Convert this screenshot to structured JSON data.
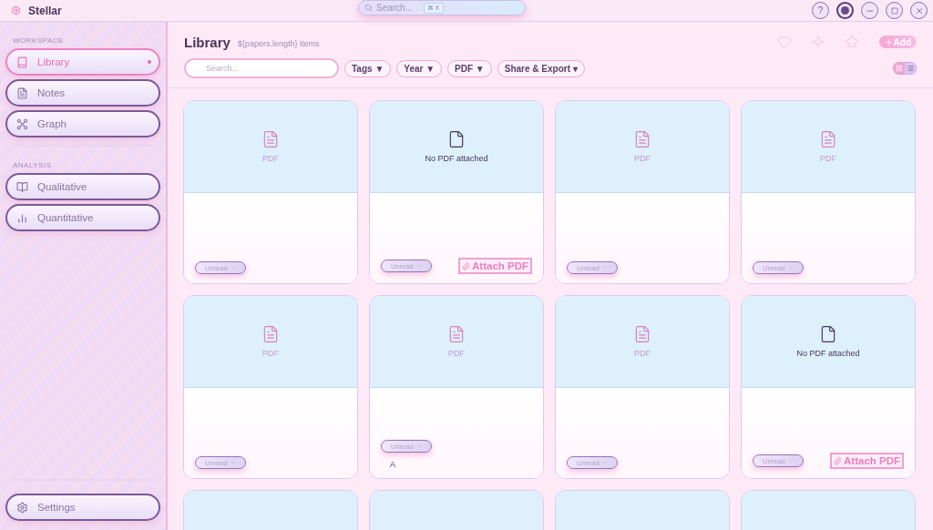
{
  "app": {
    "title": "Stellar"
  },
  "search": {
    "placeholder": "Search...",
    "shortcut": "⌘ K"
  },
  "window_controls": {
    "help": "?"
  },
  "sidebar": {
    "sections": [
      {
        "heading": "WORKSPACE",
        "items": [
          {
            "label": "Library",
            "selected": true
          },
          {
            "label": "Notes",
            "selected": false
          },
          {
            "label": "Graph",
            "selected": false
          }
        ]
      },
      {
        "heading": "ANALYSIS",
        "items": [
          {
            "label": "Qualitative",
            "selected": false
          },
          {
            "label": "Quantitative",
            "selected": false
          }
        ]
      }
    ],
    "settings": {
      "label": "Settings"
    }
  },
  "header": {
    "title": "Library",
    "count": "${papers.length} items",
    "add_button": "Add"
  },
  "filters": {
    "search_placeholder": "Search...",
    "dropdowns": [
      {
        "label": "Tags ▼"
      },
      {
        "label": "Year ▼"
      },
      {
        "label": "PDF ▼"
      },
      {
        "label": "Share & Export ▾"
      }
    ],
    "view": [
      {
        "kind": "grid",
        "selected": true
      },
      {
        "kind": "list",
        "selected": false
      }
    ]
  },
  "cards": [
    {
      "kind": "pdf",
      "label": "PDF",
      "status": "Unread"
    },
    {
      "kind": "none",
      "label": "No PDF attached",
      "status": "Unread",
      "action": "Attach PDF"
    },
    {
      "kind": "pdf",
      "label": "PDF",
      "status": "Unread"
    },
    {
      "kind": "pdf",
      "label": "PDF",
      "status": "Unread"
    },
    {
      "kind": "pdf",
      "label": "PDF",
      "status": "Unread"
    },
    {
      "kind": "pdf",
      "label": "PDF",
      "status": "Unread",
      "note": "A"
    },
    {
      "kind": "pdf",
      "label": "PDF",
      "status": "Unread"
    },
    {
      "kind": "none",
      "label": "No PDF attached",
      "status": "Unread",
      "action": "Attach PDF"
    },
    {
      "kind": "cut"
    },
    {
      "kind": "cut"
    },
    {
      "kind": "cut"
    },
    {
      "kind": "cut"
    }
  ]
}
